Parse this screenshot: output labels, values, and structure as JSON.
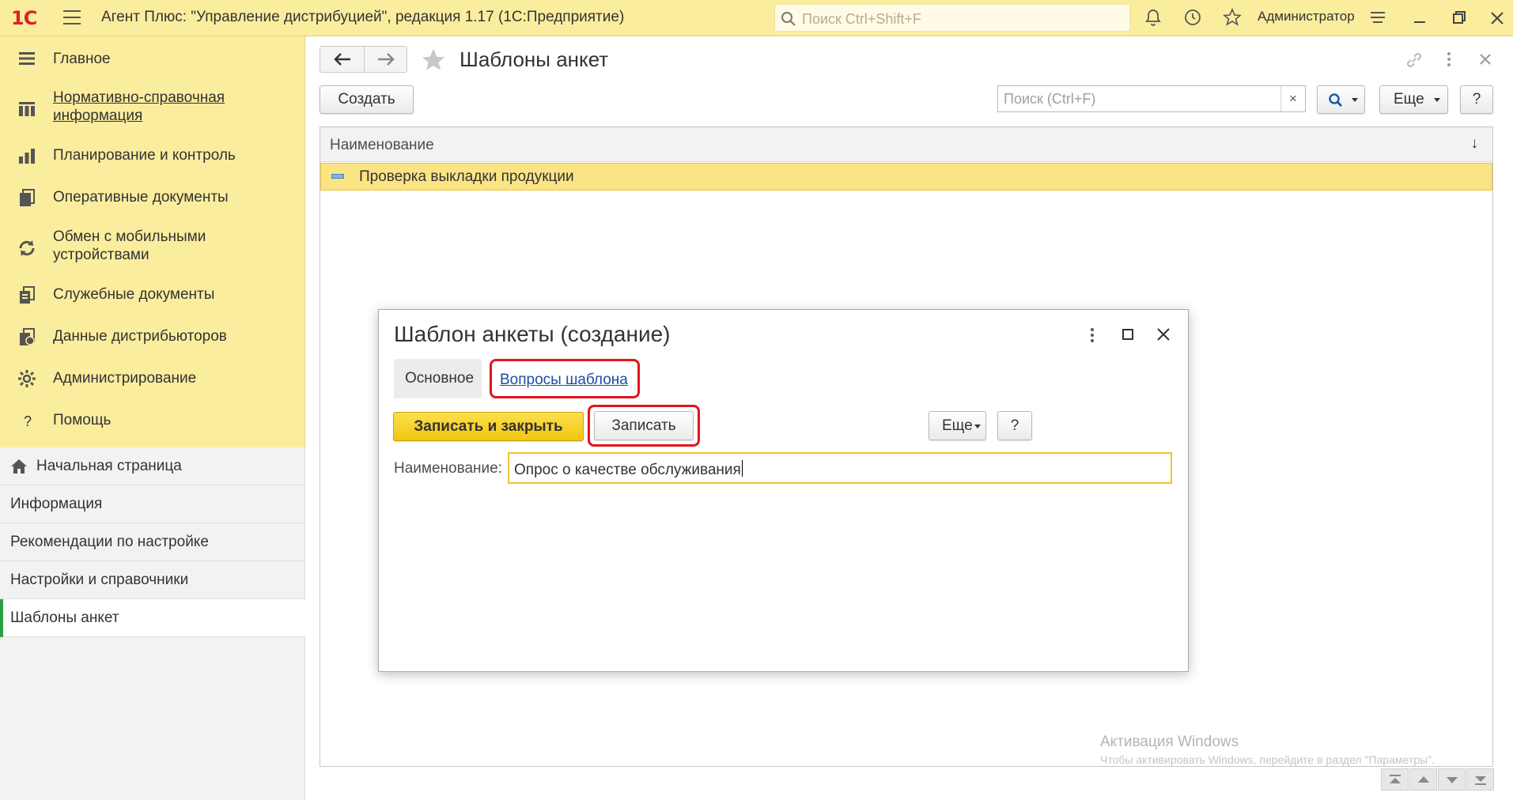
{
  "app": {
    "logo": "1С",
    "title": "Агент Плюс: \"Управление дистрибуцией\", редакция 1.17  (1С:Предприятие)",
    "search_placeholder": "Поиск Ctrl+Shift+F",
    "user": "Администратор"
  },
  "sidebar": {
    "items": [
      {
        "label": "Главное",
        "icon": "lines-icon"
      },
      {
        "label": "Нормативно-справочная информация",
        "icon": "grid-icon"
      },
      {
        "label": "Планирование и контроль",
        "icon": "bar-chart-icon"
      },
      {
        "label": "Оперативные документы",
        "icon": "documents-icon"
      },
      {
        "label": "Обмен с мобильными устройствами",
        "icon": "sync-icon"
      },
      {
        "label": "Служебные документы",
        "icon": "service-docs-icon"
      },
      {
        "label": "Данные дистрибьюторов",
        "icon": "distributor-data-icon"
      },
      {
        "label": "Администрирование",
        "icon": "gear-icon"
      },
      {
        "label": "Помощь",
        "icon": "question-icon"
      }
    ]
  },
  "lower_nav": {
    "items": [
      {
        "label": "Начальная страница"
      },
      {
        "label": "Информация"
      },
      {
        "label": "Рекомендации по настройке"
      },
      {
        "label": "Настройки и справочники"
      },
      {
        "label": "Шаблоны анкет"
      }
    ]
  },
  "list_page": {
    "title": "Шаблоны анкет",
    "create_label": "Создать",
    "search_placeholder": "Поиск (Ctrl+F)",
    "clear_label": "×",
    "more_label": "Еще",
    "help_label": "?",
    "column_header": "Наименование",
    "sort_indicator": "↓",
    "rows": [
      {
        "name": "Проверка выкладки продукции"
      }
    ]
  },
  "dialog": {
    "title": "Шаблон анкеты (создание)",
    "tabs": [
      {
        "label": "Основное"
      },
      {
        "label": "Вопросы шаблона"
      }
    ],
    "save_close_label": "Записать и закрыть",
    "save_label": "Записать",
    "more_label": "Еще",
    "help_label": "?",
    "name_label": "Наименование:",
    "name_value": "Опрос о качестве обслуживания"
  },
  "watermark": {
    "line1": "Активация Windows",
    "line2": "Чтобы активировать Windows, перейдите в раздел \"Параметры\"."
  },
  "colors": {
    "top_bar": "#fbed9e",
    "accent_yellow": "#f2c611",
    "highlight_red": "#e3151a",
    "link_blue": "#1a4ea2",
    "active_green": "#2e9e43"
  }
}
